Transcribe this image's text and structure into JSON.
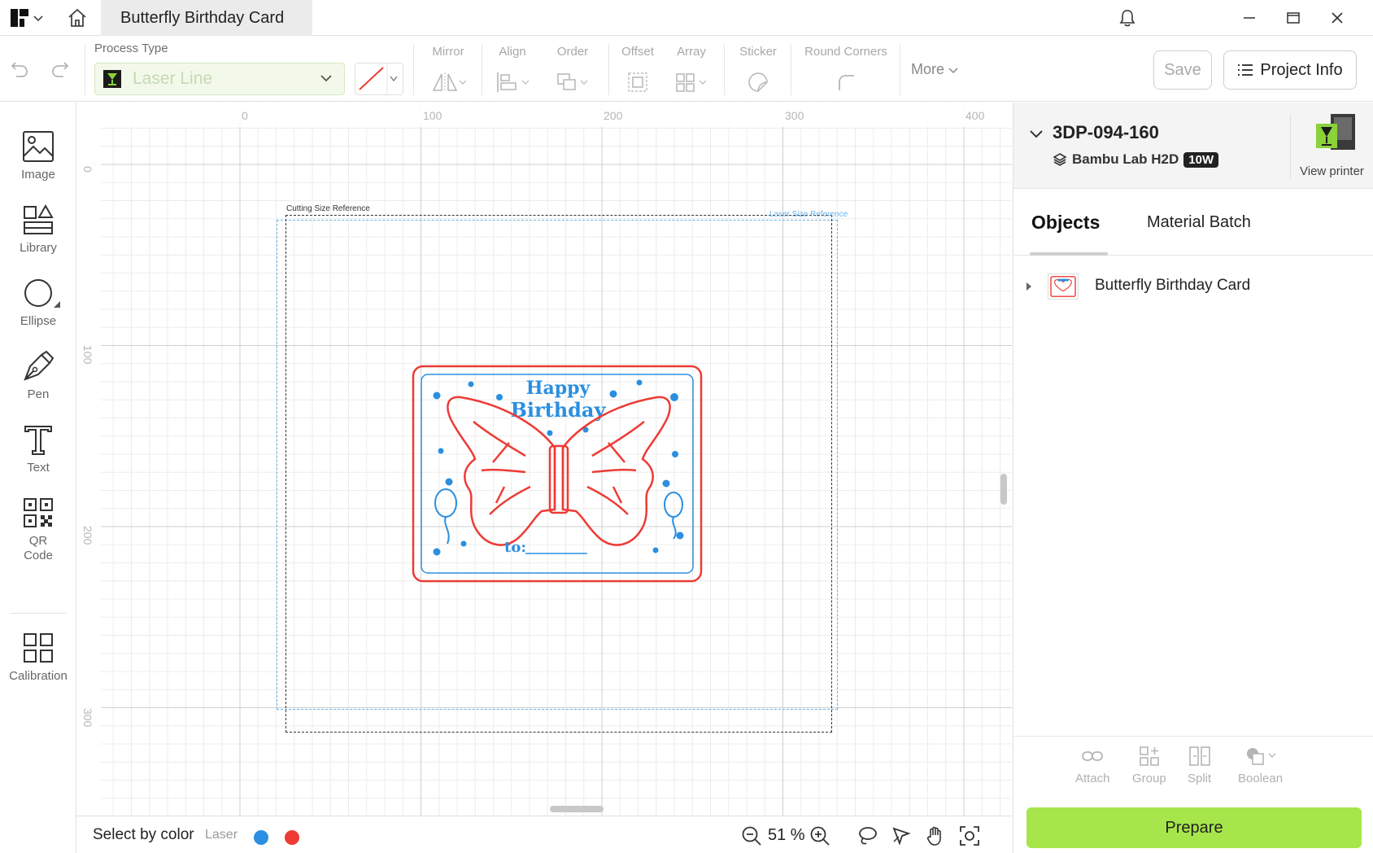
{
  "titlebar": {
    "tab_title": "Butterfly Birthday Card"
  },
  "toolbar": {
    "process_type_label": "Process Type",
    "process_type_value": "Laser Line",
    "groups": {
      "mirror": "Mirror",
      "align": "Align",
      "order": "Order",
      "offset": "Offset",
      "array": "Array",
      "sticker": "Sticker",
      "round_corners": "Round Corners"
    },
    "more_label": "More",
    "save_label": "Save",
    "project_info_label": "Project Info"
  },
  "sidebar": {
    "tools": [
      {
        "label": "Image",
        "icon": "image-icon"
      },
      {
        "label": "Library",
        "icon": "library-icon"
      },
      {
        "label": "Ellipse",
        "icon": "ellipse-icon"
      },
      {
        "label": "Pen",
        "icon": "pen-icon"
      },
      {
        "label": "Text",
        "icon": "text-icon"
      },
      {
        "label": "QR Code",
        "icon": "qr-code-icon"
      },
      {
        "label": "Calibration",
        "icon": "calibration-icon"
      }
    ]
  },
  "canvas": {
    "ruler_top": [
      "0",
      "100",
      "200",
      "300",
      "400"
    ],
    "ruler_left": [
      "0",
      "100",
      "200",
      "300"
    ],
    "cutting_ref_label": "Cutting Size Reference",
    "laser_ref_label": "Laser Size Reference",
    "card": {
      "line1": "Happy",
      "line2": "Birthday",
      "to_text": "to:",
      "outline_color": "#ee3b35",
      "inner_color": "#2a8fe0"
    }
  },
  "statusbar": {
    "select_by_color_label": "Select by color",
    "mode_label": "Laser",
    "colors": [
      "#2a8fe0",
      "#ee3b35"
    ],
    "zoom": "51 %"
  },
  "rpanel": {
    "printer_name": "3DP-094-160",
    "printer_model": "Bambu Lab H2D",
    "laser_power": "10W",
    "view_printer_label": "View printer",
    "tab_objects": "Objects",
    "tab_material_batch": "Material Batch",
    "objects": [
      {
        "name": "Butterfly Birthday Card"
      }
    ],
    "bottom_tools": {
      "attach": "Attach",
      "group": "Group",
      "split": "Split",
      "boolean": "Boolean"
    },
    "prepare_label": "Prepare"
  }
}
